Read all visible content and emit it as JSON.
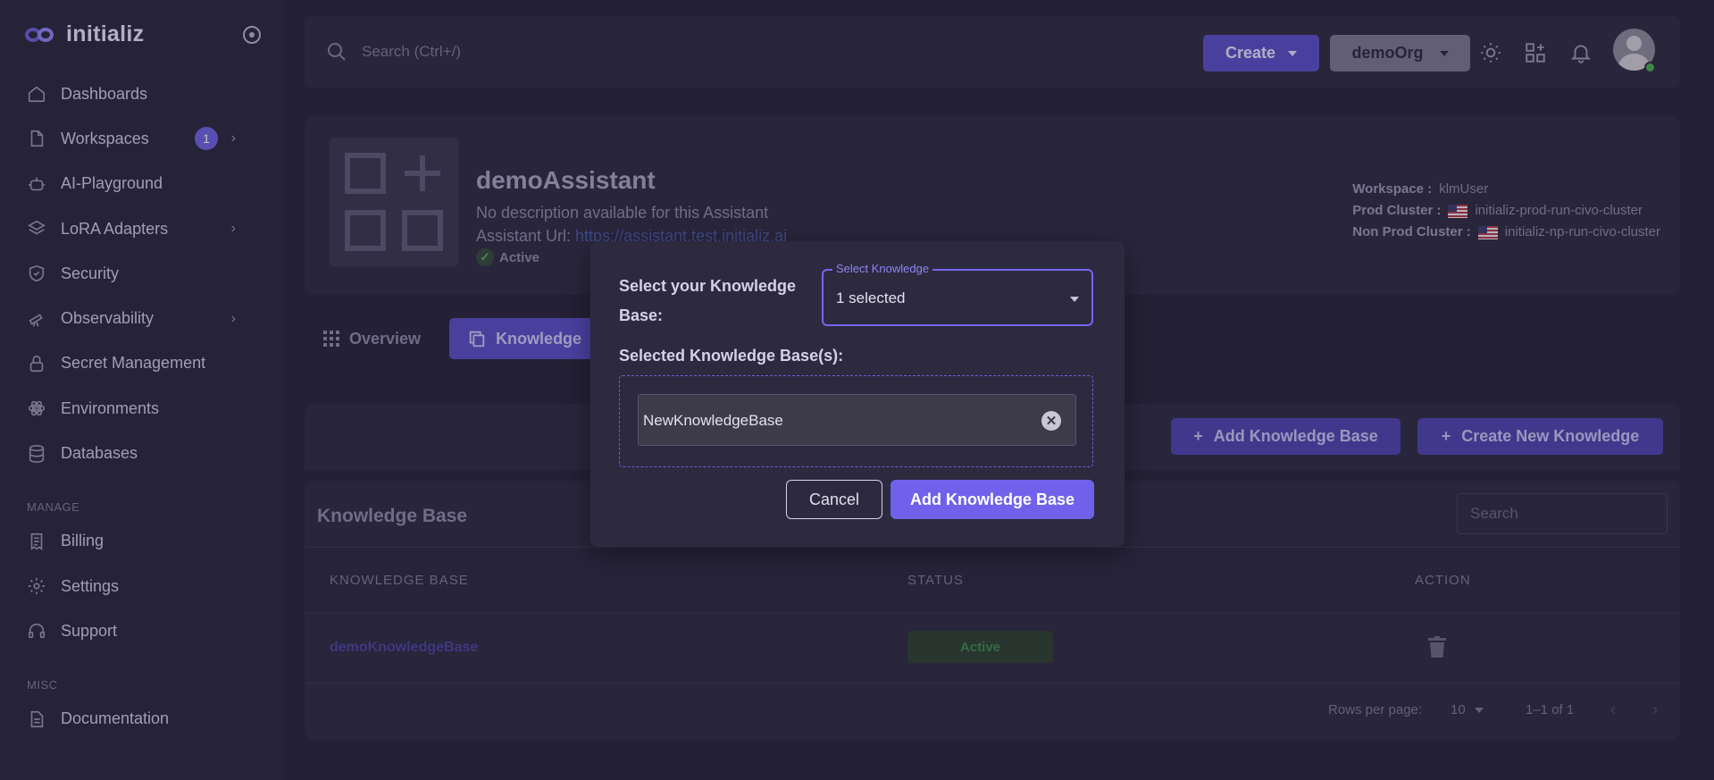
{
  "brand": {
    "name": "initializ"
  },
  "sidebar": {
    "items": [
      {
        "label": "Dashboards",
        "icon": "home-icon"
      },
      {
        "label": "Workspaces",
        "icon": "file-icon",
        "badge": "1"
      },
      {
        "label": "AI-Playground",
        "icon": "robot-icon"
      },
      {
        "label": "LoRA Adapters",
        "icon": "layers-icon"
      },
      {
        "label": "Security",
        "icon": "shield-icon"
      },
      {
        "label": "Observability",
        "icon": "telescope-icon"
      },
      {
        "label": "Secret Management",
        "icon": "lock-icon"
      },
      {
        "label": "Environments",
        "icon": "atom-icon"
      },
      {
        "label": "Databases",
        "icon": "database-icon"
      }
    ],
    "manage_label": "MANAGE",
    "manage_items": [
      {
        "label": "Billing",
        "icon": "receipt-icon"
      },
      {
        "label": "Settings",
        "icon": "gear-icon"
      },
      {
        "label": "Support",
        "icon": "headphones-icon"
      }
    ],
    "misc_label": "MISC",
    "misc_items": [
      {
        "label": "Documentation",
        "icon": "document-icon"
      }
    ]
  },
  "topbar": {
    "search_placeholder": "Search (Ctrl+/)",
    "create_label": "Create",
    "org_label": "demoOrg"
  },
  "assistant": {
    "name": "demoAssistant",
    "description": "No description available for this Assistant",
    "url_label": "Assistant Url:",
    "url": "https://assistant.test.initializ.ai",
    "status": "Active",
    "workspace_label": "Workspace :",
    "workspace": "klmUser",
    "prod_cluster_label": "Prod Cluster :",
    "prod_cluster": "initializ-prod-run-civo-cluster",
    "nonprod_cluster_label": "Non Prod Cluster :",
    "nonprod_cluster": "initializ-np-run-civo-cluster"
  },
  "tabs": [
    {
      "label": "Overview"
    },
    {
      "label": "Knowledge"
    }
  ],
  "actions": {
    "add_kb": "Add Knowledge Base",
    "create_new": "Create New Knowledge"
  },
  "kb_table": {
    "title": "Knowledge Base",
    "search_placeholder": "Search",
    "headers": [
      "KNOWLEDGE BASE",
      "STATUS",
      "ACTION"
    ],
    "rows": [
      {
        "name": "demoKnowledgeBase",
        "status": "Active"
      }
    ],
    "rows_per_page_label": "Rows per page:",
    "rows_per_page": "10",
    "range": "1–1 of 1"
  },
  "modal": {
    "select_label": "Select your Knowledge Base:",
    "select_legend": "Select Knowledge",
    "select_value": "1 selected",
    "selected_label": "Selected Knowledge Base(s):",
    "selected_items": [
      "NewKnowledgeBase"
    ],
    "cancel": "Cancel",
    "submit": "Add Knowledge Base"
  },
  "colors": {
    "accent": "#7367f0",
    "background": "#28243d",
    "surface": "#2f2b45"
  }
}
